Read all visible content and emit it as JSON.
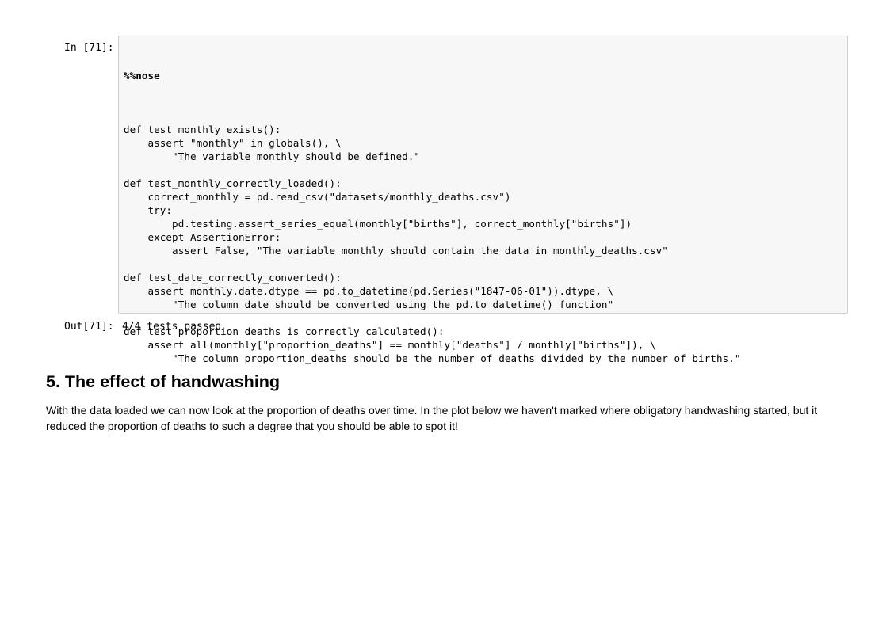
{
  "input_cell": {
    "prompt": "In [71]:",
    "magic": "%%nose",
    "code_lines": [
      "",
      "def test_monthly_exists():",
      "    assert \"monthly\" in globals(), \\",
      "        \"The variable monthly should be defined.\"",
      "",
      "def test_monthly_correctly_loaded():",
      "    correct_monthly = pd.read_csv(\"datasets/monthly_deaths.csv\")",
      "    try:",
      "        pd.testing.assert_series_equal(monthly[\"births\"], correct_monthly[\"births\"])",
      "    except AssertionError:",
      "        assert False, \"The variable monthly should contain the data in monthly_deaths.csv\"",
      "",
      "def test_date_correctly_converted():",
      "    assert monthly.date.dtype == pd.to_datetime(pd.Series(\"1847-06-01\")).dtype, \\",
      "        \"The column date should be converted using the pd.to_datetime() function\"",
      "",
      "def test_proportion_deaths_is_correctly_calculated():",
      "    assert all(monthly[\"proportion_deaths\"] == monthly[\"deaths\"] / monthly[\"births\"]), \\",
      "        \"The column proportion_deaths should be the number of deaths divided by the number of births.\""
    ]
  },
  "output_cell": {
    "prompt": "Out[71]:",
    "text": "4/4 tests passed"
  },
  "markdown": {
    "heading": "5. The effect of handwashing",
    "paragraph": "With the data loaded we can now look at the proportion of deaths over time. In the plot below we haven't marked where obligatory handwashing started, but it reduced the proportion of deaths to such a degree that you should be able to spot it!"
  }
}
